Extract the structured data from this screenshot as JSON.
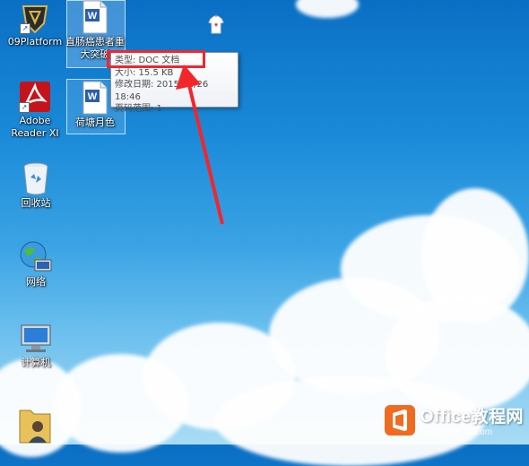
{
  "desktop_icons": {
    "platform": {
      "label": "09Platform"
    },
    "doc1": {
      "label_line1": "直肠癌患者重",
      "label_line2": "大突破"
    },
    "doc2": {
      "label": "荷塘月色"
    },
    "adobe": {
      "label_line1": "Adobe",
      "label_line2": "Reader XI"
    },
    "recycle": {
      "label": "回收站"
    },
    "network": {
      "label": "网络"
    },
    "computer": {
      "label": "计算机"
    }
  },
  "tooltip": {
    "type_line": "类型: DOC 文档",
    "size_line": "大小: 15.5 KB",
    "modified_line": "修改日期: 2015/12/26 18:46",
    "pages_line": "页码范围: 1"
  },
  "watermark": {
    "brand": "Office教程网",
    "url": "www.office26.com"
  },
  "colors": {
    "highlight_red": "#f2262b",
    "watermark_orange": "#f06b1f"
  }
}
